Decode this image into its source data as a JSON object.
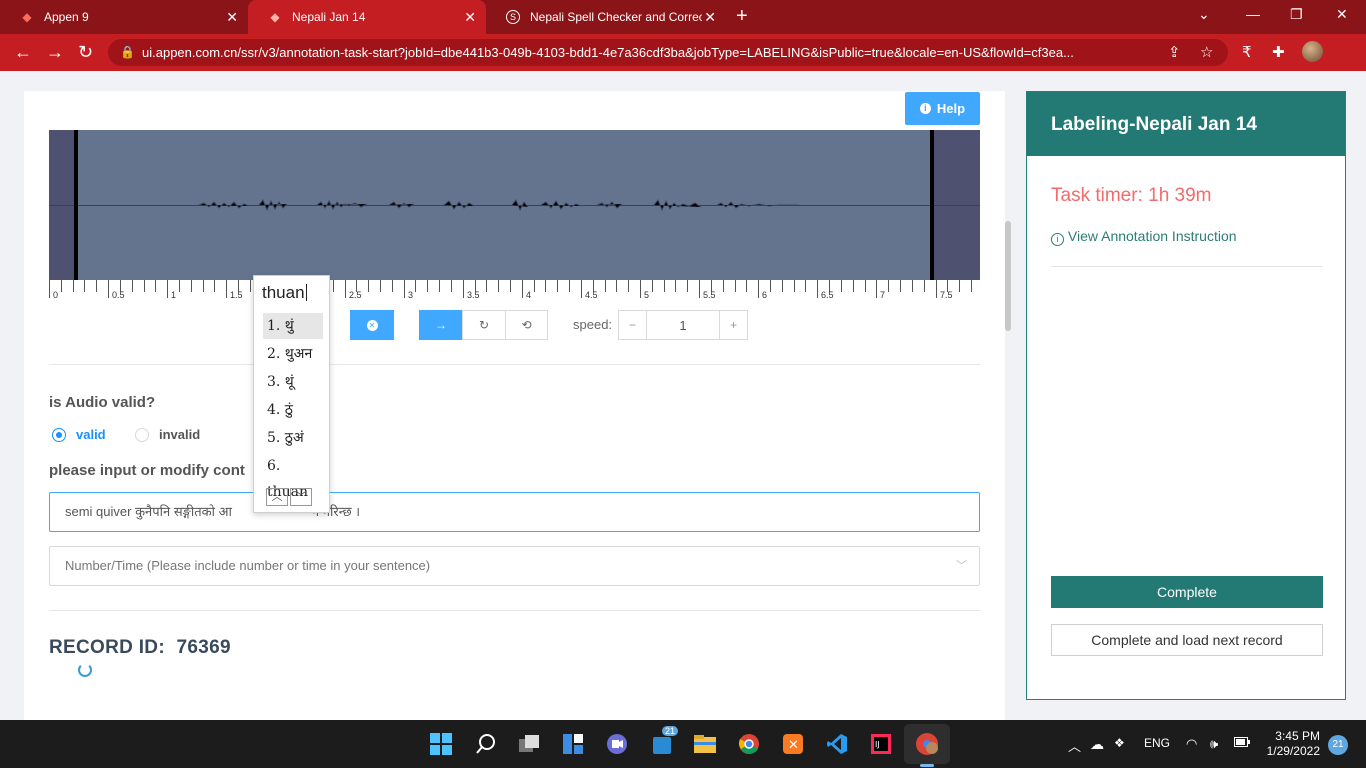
{
  "browser": {
    "tabs": [
      {
        "title": "Appen 9",
        "icon": "appen-icon"
      },
      {
        "title": "Nepali Jan 14",
        "icon": "appen-icon"
      },
      {
        "title": "Nepali Spell Checker and Correct",
        "icon": "spellcheck-icon"
      }
    ],
    "url": "ui.appen.com.cn/ssr/v3/annotation-task-start?jobId=dbe441b3-049b-4103-bdd1-4e7a36cdf3ba&jobType=LABELING&isPublic=true&locale=en-US&flowId=cf3ea..."
  },
  "toolbar": {
    "help_label": "Help"
  },
  "waveform": {
    "ticks": [
      "0",
      "0.5",
      "1",
      "1.5",
      "2",
      "2.5",
      "3",
      "3.5",
      "4",
      "4.5",
      "5",
      "5.5",
      "6",
      "6.5",
      "7",
      "7.5"
    ]
  },
  "playback": {
    "speed_label": "speed:",
    "speed_value": "1",
    "minus": "−",
    "plus": "+"
  },
  "form": {
    "audio_question": "is Audio valid?",
    "opt_valid": "valid",
    "opt_invalid": "invalid",
    "input_question": "please input or modify cont",
    "transcript": "semi quiver कुनैपनि सङ्गीतको आ",
    "transcript_tail": "नै गरिन्छ ।",
    "number_time_placeholder": "Number/Time (Please include number or time in your sentence)",
    "record_id_label": "RECORD ID:",
    "record_id_value": "76369"
  },
  "ime": {
    "composition": "thuan",
    "candidates": [
      "1. थुं",
      "2. थुअन",
      "3. थूं",
      "4. ठुं",
      "5. ठुअं",
      "6. thuan"
    ]
  },
  "side": {
    "title": "Labeling-Nepali Jan 14",
    "timer": "Task timer: 1h 39m",
    "instruction_link": "View Annotation Instruction",
    "complete_label": "Complete",
    "complete_next_label": "Complete and load next record"
  },
  "taskbar": {
    "lang": "ENG",
    "time": "3:45 PM",
    "date": "1/29/2022",
    "notifications": "21",
    "badge_teams": "21"
  }
}
